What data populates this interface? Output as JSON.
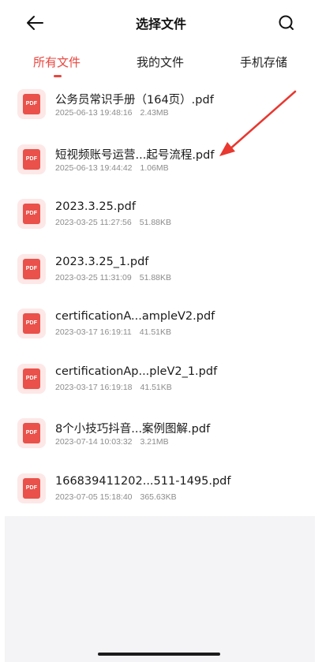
{
  "header": {
    "title": "选择文件",
    "back_icon": "arrow-left-icon",
    "search_icon": "search-icon"
  },
  "tabs": [
    {
      "label": "所有文件",
      "active": true
    },
    {
      "label": "我的文件",
      "active": false
    },
    {
      "label": "手机存储",
      "active": false
    }
  ],
  "files": [
    {
      "icon_text": "PDF",
      "name": "公务员常识手册（164页）.pdf",
      "datetime": "2025-06-13 19:48:16",
      "size": "2.43MB"
    },
    {
      "icon_text": "PDF",
      "name": "短视频账号运营...起号流程.pdf",
      "datetime": "2025-06-13 19:44:42",
      "size": "1.06MB"
    },
    {
      "icon_text": "PDF",
      "name": "2023.3.25.pdf",
      "datetime": "2023-03-25 11:27:56",
      "size": "51.88KB"
    },
    {
      "icon_text": "PDF",
      "name": "2023.3.25_1.pdf",
      "datetime": "2023-03-25 11:31:09",
      "size": "51.88KB"
    },
    {
      "icon_text": "PDF",
      "name": "certificationA...ampleV2.pdf",
      "datetime": "2023-03-17 16:19:11",
      "size": "41.51KB"
    },
    {
      "icon_text": "PDF",
      "name": "certificationAp...pleV2_1.pdf",
      "datetime": "2023-03-17 16:19:18",
      "size": "41.51KB"
    },
    {
      "icon_text": "PDF",
      "name": "8个小技巧抖音...案例图解.pdf",
      "datetime": "2023-07-14 10:03:32",
      "size": "3.21MB"
    },
    {
      "icon_text": "PDF",
      "name": "166839411202...511-1495.pdf",
      "datetime": "2023-07-05 15:18:40",
      "size": "365.63KB"
    }
  ],
  "colors": {
    "accent": "#e8463e",
    "pdf_icon": "#e9514a",
    "annotation_arrow": "#e8382f"
  }
}
